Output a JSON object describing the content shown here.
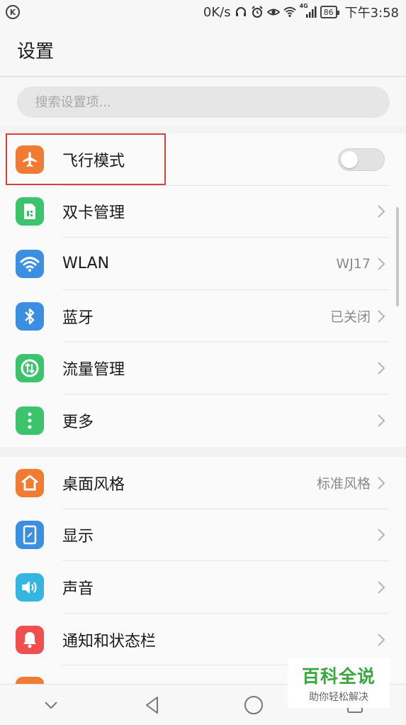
{
  "status_bar": {
    "left_badge": "K",
    "speed": "0K/s",
    "network": "4G",
    "battery": "86",
    "time": "下午3:58"
  },
  "header": {
    "title": "设置"
  },
  "search": {
    "placeholder": "搜索设置项..."
  },
  "groups": [
    {
      "items": [
        {
          "label": "飞行模式",
          "icon": "airplane-icon",
          "color": "#f07c33",
          "control": "toggle",
          "toggle_on": false
        },
        {
          "label": "双卡管理",
          "icon": "sim-card-icon",
          "color": "#3cc46d",
          "control": "chevron"
        },
        {
          "label": "WLAN",
          "icon": "wifi-icon",
          "color": "#3c8fe0",
          "control": "chevron",
          "value": "WJ17"
        },
        {
          "label": "蓝牙",
          "icon": "bluetooth-icon",
          "color": "#3c8fe0",
          "control": "chevron",
          "value": "已关闭"
        },
        {
          "label": "流量管理",
          "icon": "data-usage-icon",
          "color": "#3cc46d",
          "control": "chevron"
        },
        {
          "label": "更多",
          "icon": "more-dots-icon",
          "color": "#3cc46d",
          "control": "chevron"
        }
      ]
    },
    {
      "items": [
        {
          "label": "桌面风格",
          "icon": "home-icon",
          "color": "#f07c33",
          "control": "chevron",
          "value": "标准风格"
        },
        {
          "label": "显示",
          "icon": "display-icon",
          "color": "#3c8fe0",
          "control": "chevron"
        },
        {
          "label": "声音",
          "icon": "speaker-icon",
          "color": "#35b6e0",
          "control": "chevron"
        },
        {
          "label": "通知和状态栏",
          "icon": "bell-icon",
          "color": "#ef4f4f",
          "control": "chevron"
        }
      ]
    }
  ],
  "watermark": {
    "title": "百科全说",
    "subtitle": "助你轻松解决"
  }
}
